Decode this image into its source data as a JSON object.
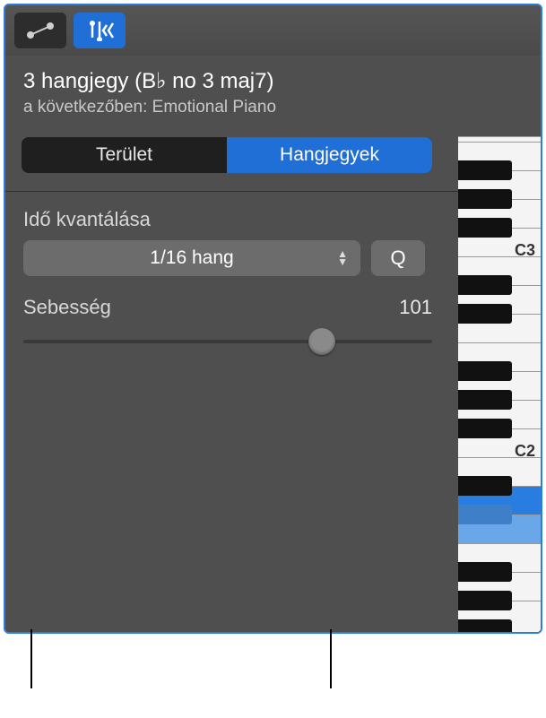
{
  "header": {
    "title": "3 hangjegy (B♭ no 3 maj7)",
    "subtitle": "a következőben: Emotional Piano"
  },
  "segments": {
    "region": "Terület",
    "notes": "Hangjegyek"
  },
  "quantize": {
    "label": "Idő kvantálása",
    "value": "1/16 hang",
    "button": "Q"
  },
  "velocity": {
    "label": "Sebesség",
    "value": "101"
  },
  "piano": {
    "c3": "C3",
    "c2": "C2"
  },
  "icons": {
    "automation": "automation-icon",
    "midi_in": "midi-in-icon"
  }
}
